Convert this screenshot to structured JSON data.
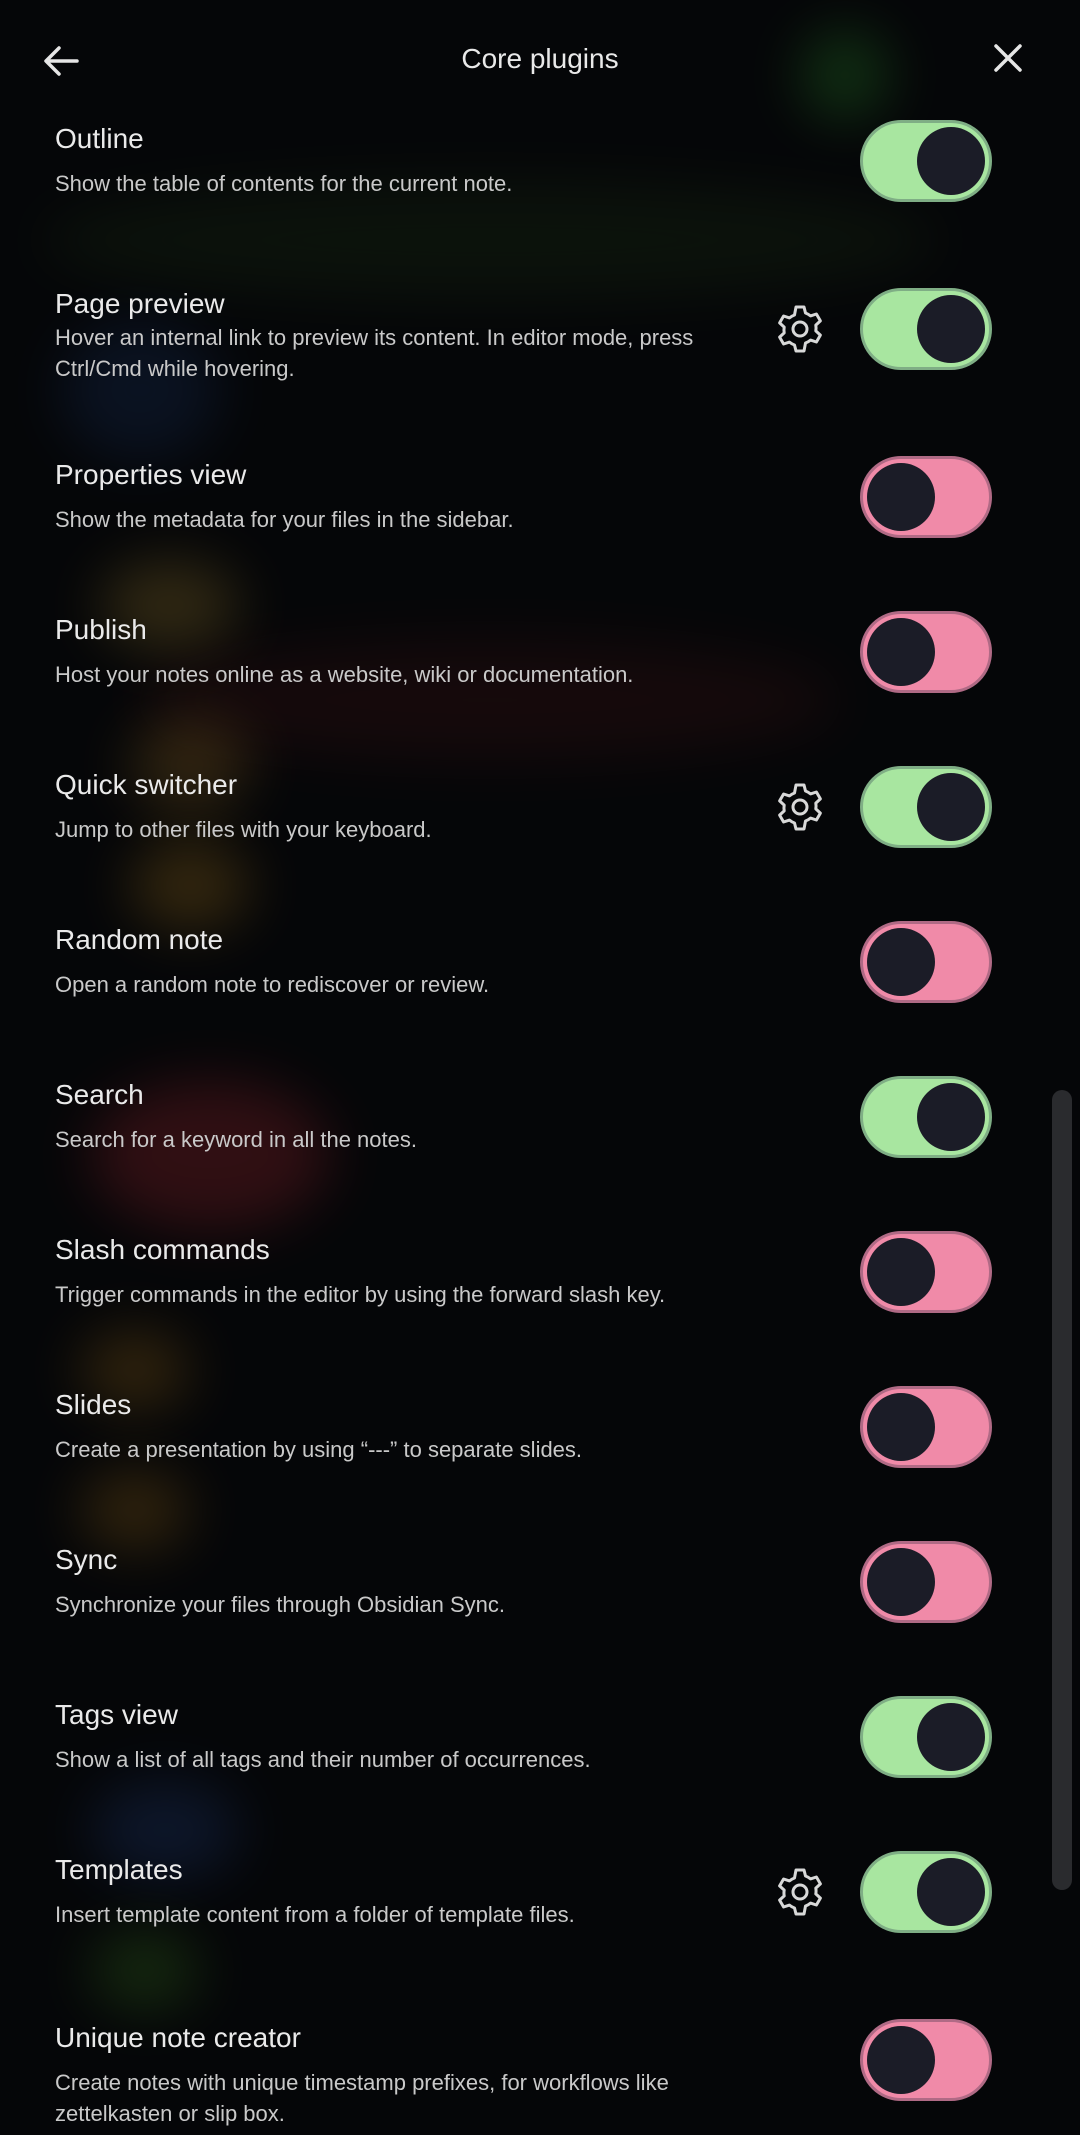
{
  "header": {
    "title": "Core plugins",
    "back_icon": "arrow-left-icon",
    "close_icon": "close-icon"
  },
  "colors": {
    "toggle_on": "#a8e6a0",
    "toggle_off": "#f08aa8",
    "knob": "#1b1c27",
    "background": "#050608"
  },
  "plugins": [
    {
      "name": "Outline",
      "description": "Show the table of contents for the current note.",
      "enabled": true,
      "settings": false
    },
    {
      "name": "Page preview",
      "description": "Hover an internal link to preview its content. In editor mode, press Ctrl/Cmd while hovering.",
      "enabled": true,
      "settings": true
    },
    {
      "name": "Properties view",
      "description": "Show the metadata for your files in the sidebar.",
      "enabled": false,
      "settings": false
    },
    {
      "name": "Publish",
      "description": "Host your notes online as a website, wiki or documentation.",
      "enabled": false,
      "settings": false
    },
    {
      "name": "Quick switcher",
      "description": "Jump to other files with your keyboard.",
      "enabled": true,
      "settings": true
    },
    {
      "name": "Random note",
      "description": "Open a random note to rediscover or review.",
      "enabled": false,
      "settings": false
    },
    {
      "name": "Search",
      "description": "Search for a keyword in all the notes.",
      "enabled": true,
      "settings": false
    },
    {
      "name": "Slash commands",
      "description": "Trigger commands in the editor by using the forward slash key.",
      "enabled": false,
      "settings": false
    },
    {
      "name": "Slides",
      "description": "Create a presentation by using “---” to separate slides.",
      "enabled": false,
      "settings": false
    },
    {
      "name": "Sync",
      "description": "Synchronize your files through Obsidian Sync.",
      "enabled": false,
      "settings": false
    },
    {
      "name": "Tags view",
      "description": "Show a list of all tags and their number of occurrences.",
      "enabled": true,
      "settings": false
    },
    {
      "name": "Templates",
      "description": "Insert template content from a folder of template files.",
      "enabled": true,
      "settings": true
    },
    {
      "name": "Unique note creator",
      "description": "Create notes with unique timestamp prefixes, for workflows like zettelkasten or slip box.",
      "enabled": false,
      "settings": false
    }
  ]
}
